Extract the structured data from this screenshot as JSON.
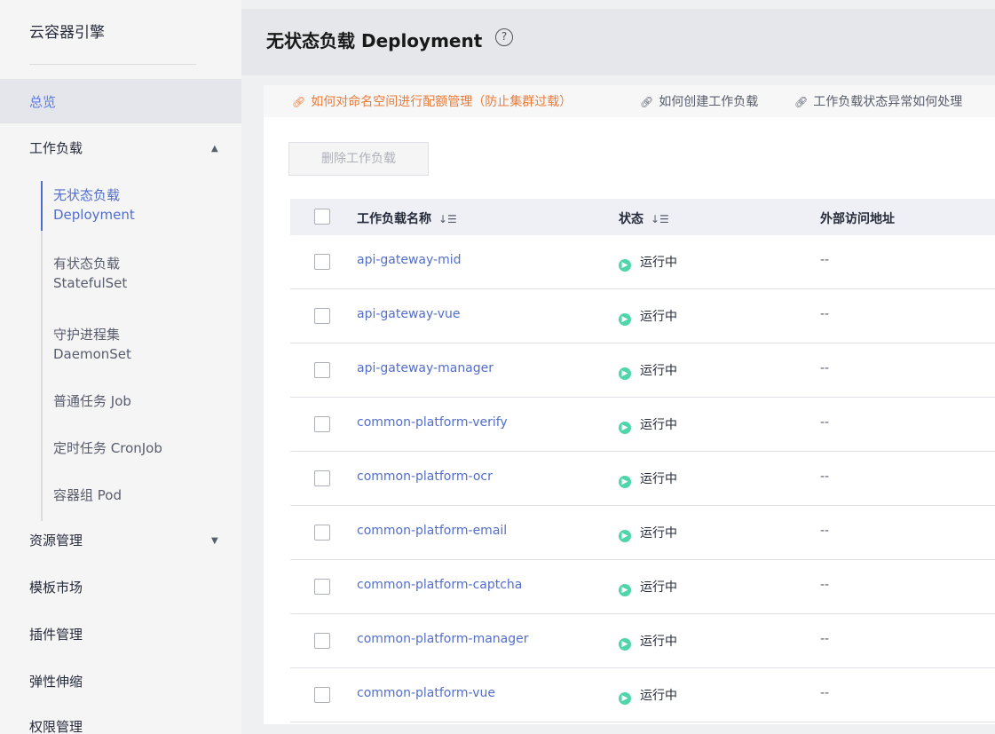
{
  "sidebar": {
    "brand": "云容器引擎",
    "overview": "总览",
    "workload": "工作负载",
    "workload_caret": "▲",
    "sub": [
      {
        "cn": "无状态负载",
        "en": "Deployment"
      },
      {
        "cn": "有状态负载",
        "en": "StatefulSet"
      },
      {
        "cn": "守护进程集",
        "en": "DaemonSet"
      },
      {
        "cn": "普通任务 Job",
        "en": ""
      },
      {
        "cn": "定时任务 CronJob",
        "en": ""
      },
      {
        "cn": "容器组 Pod",
        "en": ""
      }
    ],
    "resources": "资源管理",
    "resources_caret": "▼",
    "market": "模板市场",
    "plugins": "插件管理",
    "scaling": "弹性伸缩",
    "permissions": "权限管理"
  },
  "header": {
    "title": "无状态负载 Deployment",
    "help_icon": "?"
  },
  "help_links": [
    "如何对命名空间进行配额管理（防止集群过载）",
    "如何创建工作负载",
    "工作负载状态异常如何处理"
  ],
  "toolbar": {
    "delete_label": "删除工作负载"
  },
  "table": {
    "columns": [
      "工作负载名称",
      "状态",
      "外部访问地址"
    ],
    "sort_icon": "↓☰",
    "rows": [
      {
        "name": "api-gateway-mid",
        "status": "运行中",
        "address": "--"
      },
      {
        "name": "api-gateway-vue",
        "status": "运行中",
        "address": "--"
      },
      {
        "name": "api-gateway-manager",
        "status": "运行中",
        "address": "--"
      },
      {
        "name": "common-platform-verify",
        "status": "运行中",
        "address": "--"
      },
      {
        "name": "common-platform-ocr",
        "status": "运行中",
        "address": "--"
      },
      {
        "name": "common-platform-email",
        "status": "运行中",
        "address": "--"
      },
      {
        "name": "common-platform-captcha",
        "status": "运行中",
        "address": "--"
      },
      {
        "name": "common-platform-manager",
        "status": "运行中",
        "address": "--"
      },
      {
        "name": "common-platform-vue",
        "status": "运行中",
        "address": "--"
      }
    ]
  },
  "colors": {
    "accent": "#526ecc",
    "link_orange": "#ea7b3a",
    "running_green": "#50d4ab"
  }
}
